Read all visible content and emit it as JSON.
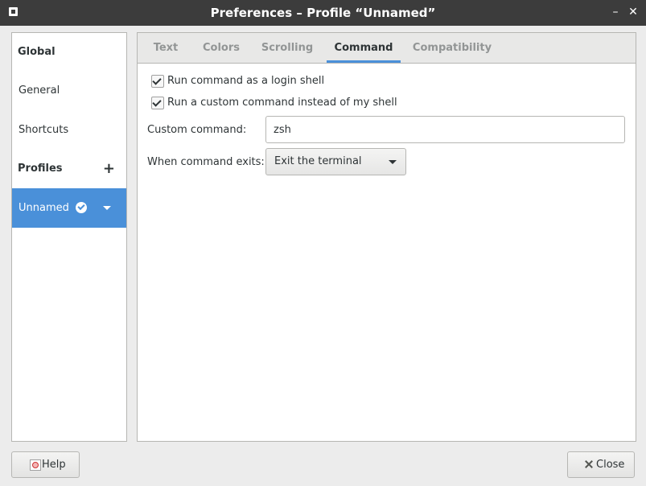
{
  "window": {
    "title": "Preferences – Profile “Unnamed”",
    "minimize_icon": "minimize-icon",
    "close_icon": "close-icon",
    "minimize_glyph": "–",
    "close_glyph": "✕"
  },
  "sidebar": {
    "global_header": "Global",
    "items": [
      {
        "label": "General"
      },
      {
        "label": "Shortcuts"
      }
    ],
    "profiles_header": "Profiles",
    "add_profile_glyph": "+",
    "profiles": [
      {
        "label": "Unnamed",
        "is_default": true,
        "selected": true
      }
    ]
  },
  "tabs": [
    {
      "label": "Text",
      "active": false
    },
    {
      "label": "Colors",
      "active": false
    },
    {
      "label": "Scrolling",
      "active": false
    },
    {
      "label": "Command",
      "active": true
    },
    {
      "label": "Compatibility",
      "active": false
    }
  ],
  "command": {
    "login_shell": {
      "label": "Run command as a login shell",
      "checked": true
    },
    "custom_command_toggle": {
      "label": "Run a custom command instead of my shell",
      "checked": true
    },
    "custom_command_label": "Custom command:",
    "custom_command_value": "zsh",
    "exit_label": "When command exits:",
    "exit_value": "Exit the terminal"
  },
  "buttons": {
    "help_label": "Help",
    "close_label": "Close"
  },
  "colors": {
    "accent": "#4a90d9",
    "titlebar": "#3c3c3c",
    "background": "#ececec"
  }
}
